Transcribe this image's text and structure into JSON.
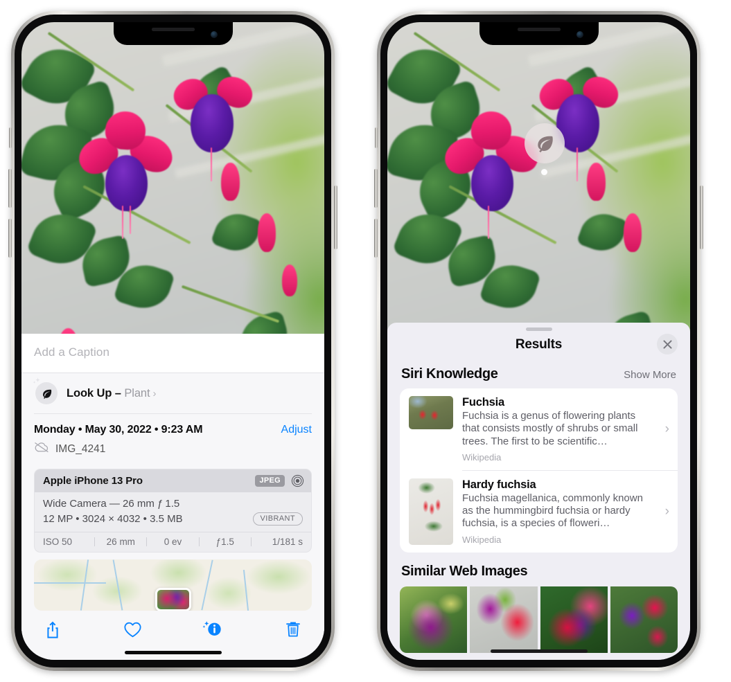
{
  "left_phone": {
    "photo": {
      "alt": "fuchsia-flowers-photo"
    },
    "caption": {
      "placeholder": "Add a Caption",
      "value": ""
    },
    "lookup": {
      "label": "Look Up – ",
      "subject": "Plant",
      "icon": "leaf-icon",
      "chevron": "›"
    },
    "metadata": {
      "date": "Monday • May 30, 2022 • 9:23 AM",
      "adjust_label": "Adjust",
      "filename": "IMG_4241",
      "cloud_icon": "cloud-slash-icon"
    },
    "camera": {
      "model": "Apple iPhone 13 Pro",
      "format_badge": "JPEG",
      "raw_icon": "aperture-ring-icon",
      "lens": "Wide Camera — 26 mm ƒ 1.5",
      "specs": "12 MP • 3024 × 4032 • 3.5 MB",
      "style_badge": "VIBRANT",
      "exif": [
        "ISO 50",
        "26 mm",
        "0 ev",
        "ƒ1.5",
        "1/181 s"
      ]
    },
    "map": {
      "alt": "location-map-thumbnail"
    },
    "toolbar": [
      {
        "name": "share-button",
        "icon": "share-icon"
      },
      {
        "name": "favorite-button",
        "icon": "heart-icon"
      },
      {
        "name": "info-button",
        "icon": "info-sparkle-icon"
      },
      {
        "name": "delete-button",
        "icon": "trash-icon"
      }
    ]
  },
  "right_phone": {
    "visual_lookup_badge": {
      "icon": "leaf-icon"
    },
    "sheet": {
      "title": "Results",
      "close_icon": "close-icon"
    },
    "siri_knowledge": {
      "title": "Siri Knowledge",
      "show_more": "Show More",
      "items": [
        {
          "title": "Fuchsia",
          "description": "Fuchsia is a genus of flowering plants that consists mostly of shrubs or small trees. The first to be scientific…",
          "source": "Wikipedia",
          "chevron": "›"
        },
        {
          "title": "Hardy fuchsia",
          "description": "Fuchsia magellanica, commonly known as the hummingbird fuchsia or hardy fuchsia, is a species of floweri…",
          "source": "Wikipedia",
          "chevron": "›"
        }
      ]
    },
    "similar_web_images": {
      "title": "Similar Web Images",
      "images": [
        "web-image-1",
        "web-image-2",
        "web-image-3",
        "web-image-4"
      ]
    }
  },
  "colors": {
    "accent_blue": "#0a84ff",
    "sheet_bg": "#efeef4",
    "info_bg": "#f7f7f9",
    "card_bg": "#ffffff"
  }
}
